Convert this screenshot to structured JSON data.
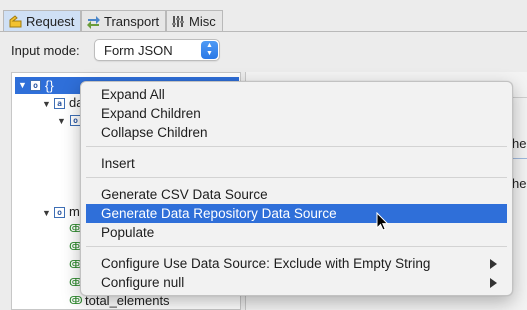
{
  "tabs": [
    {
      "label": "Request",
      "icon": "request-icon",
      "active": true
    },
    {
      "label": "Transport",
      "icon": "transport-icon",
      "active": false
    },
    {
      "label": "Misc",
      "icon": "misc-icon",
      "active": false
    }
  ],
  "input_mode": {
    "label": "Input mode:",
    "value": "Form JSON"
  },
  "tree": {
    "root_label": "{}",
    "nodes": [
      {
        "label": "da",
        "type_badge": "a"
      },
      {
        "label": "m",
        "type_badge": "o"
      },
      {
        "label": "total_elements"
      }
    ]
  },
  "right_panel": {
    "frag_top": "he",
    "frag_mid": "he"
  },
  "context_menu": {
    "items": [
      "Expand All",
      "Expand Children",
      "Collapse Children",
      "Insert",
      "Generate CSV Data Source",
      "Generate Data Repository Data Source",
      "Populate",
      "Configure Use Data Source: Exclude with Empty String",
      "Configure null"
    ],
    "highlighted": "Generate Data Repository Data Source"
  },
  "colors": {
    "selection": "#2f6fd9",
    "active_tab": "#cfe0f5"
  }
}
